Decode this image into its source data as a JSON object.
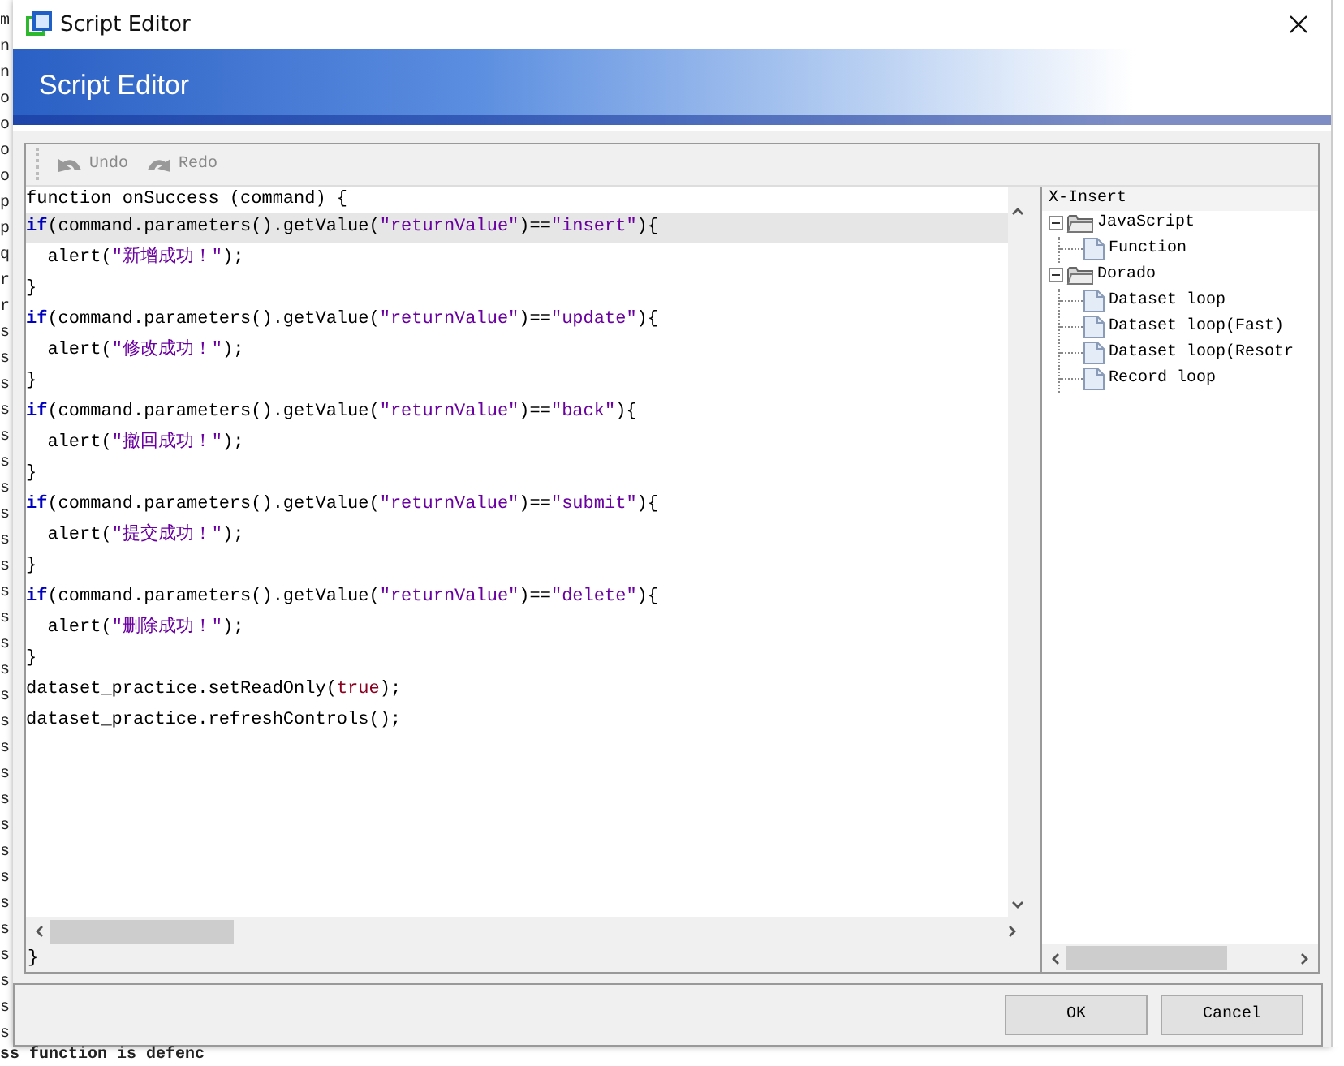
{
  "background": {
    "column_letters": [
      "m",
      "n",
      "n",
      "o",
      "o",
      "o",
      "o",
      "p",
      "p",
      "q",
      "r",
      "r",
      "s",
      "s",
      "s",
      "s",
      "s",
      "s",
      "s",
      "s",
      "s",
      "s",
      "s",
      "s",
      "s",
      "s",
      "s",
      "s",
      "s",
      "s",
      "s",
      "s",
      "s",
      "s",
      "s",
      "s",
      "s",
      "s",
      "s",
      "s"
    ],
    "bottom_text": "ss function is defenc"
  },
  "window": {
    "title": "Script Editor"
  },
  "banner": {
    "title": "Script Editor"
  },
  "toolbar": [
    {
      "kind": "undo",
      "label": "Undo",
      "disabled": true
    },
    {
      "kind": "redo",
      "label": "Redo",
      "disabled": true
    }
  ],
  "code": {
    "lines": [
      {
        "current": false,
        "segments": [
          {
            "kind": "plain",
            "text": "function onSuccess (command) {"
          }
        ]
      },
      {
        "current": true,
        "segments": [
          {
            "kind": "keyword",
            "text": "if"
          },
          {
            "kind": "plain",
            "text": "(command.parameters().getValue("
          },
          {
            "kind": "string",
            "text": "\"returnValue\""
          },
          {
            "kind": "plain",
            "text": ")=="
          },
          {
            "kind": "string",
            "text": "\"insert\""
          },
          {
            "kind": "plain",
            "text": "){"
          }
        ]
      },
      {
        "current": false,
        "segments": [
          {
            "kind": "plain",
            "text": "  alert("
          },
          {
            "kind": "string",
            "text": "\"新增成功！\""
          },
          {
            "kind": "plain",
            "text": ");"
          }
        ]
      },
      {
        "current": false,
        "segments": [
          {
            "kind": "plain",
            "text": "}"
          }
        ]
      },
      {
        "current": false,
        "segments": [
          {
            "kind": "keyword",
            "text": "if"
          },
          {
            "kind": "plain",
            "text": "(command.parameters().getValue("
          },
          {
            "kind": "string",
            "text": "\"returnValue\""
          },
          {
            "kind": "plain",
            "text": ")=="
          },
          {
            "kind": "string",
            "text": "\"update\""
          },
          {
            "kind": "plain",
            "text": "){"
          }
        ]
      },
      {
        "current": false,
        "segments": [
          {
            "kind": "plain",
            "text": "  alert("
          },
          {
            "kind": "string",
            "text": "\"修改成功！\""
          },
          {
            "kind": "plain",
            "text": ");"
          }
        ]
      },
      {
        "current": false,
        "segments": [
          {
            "kind": "plain",
            "text": "}"
          }
        ]
      },
      {
        "current": false,
        "segments": [
          {
            "kind": "keyword",
            "text": "if"
          },
          {
            "kind": "plain",
            "text": "(command.parameters().getValue("
          },
          {
            "kind": "string",
            "text": "\"returnValue\""
          },
          {
            "kind": "plain",
            "text": ")=="
          },
          {
            "kind": "string",
            "text": "\"back\""
          },
          {
            "kind": "plain",
            "text": "){"
          }
        ]
      },
      {
        "current": false,
        "segments": [
          {
            "kind": "plain",
            "text": "  alert("
          },
          {
            "kind": "string",
            "text": "\"撤回成功！\""
          },
          {
            "kind": "plain",
            "text": ");"
          }
        ]
      },
      {
        "current": false,
        "segments": [
          {
            "kind": "plain",
            "text": "}"
          }
        ]
      },
      {
        "current": false,
        "segments": [
          {
            "kind": "keyword",
            "text": "if"
          },
          {
            "kind": "plain",
            "text": "(command.parameters().getValue("
          },
          {
            "kind": "string",
            "text": "\"returnValue\""
          },
          {
            "kind": "plain",
            "text": ")=="
          },
          {
            "kind": "string",
            "text": "\"submit\""
          },
          {
            "kind": "plain",
            "text": "){"
          }
        ]
      },
      {
        "current": false,
        "segments": [
          {
            "kind": "plain",
            "text": "  alert("
          },
          {
            "kind": "string",
            "text": "\"提交成功！\""
          },
          {
            "kind": "plain",
            "text": ");"
          }
        ]
      },
      {
        "current": false,
        "segments": [
          {
            "kind": "plain",
            "text": "}"
          }
        ]
      },
      {
        "current": false,
        "segments": [
          {
            "kind": "keyword",
            "text": "if"
          },
          {
            "kind": "plain",
            "text": "(command.parameters().getValue("
          },
          {
            "kind": "string",
            "text": "\"returnValue\""
          },
          {
            "kind": "plain",
            "text": ")=="
          },
          {
            "kind": "string",
            "text": "\"delete\""
          },
          {
            "kind": "plain",
            "text": "){"
          }
        ]
      },
      {
        "current": false,
        "segments": [
          {
            "kind": "plain",
            "text": "  alert("
          },
          {
            "kind": "string",
            "text": "\"删除成功！\""
          },
          {
            "kind": "plain",
            "text": ");"
          }
        ]
      },
      {
        "current": false,
        "segments": [
          {
            "kind": "plain",
            "text": "}"
          }
        ]
      },
      {
        "current": false,
        "segments": [
          {
            "kind": "plain",
            "text": "dataset_practice.setReadOnly("
          },
          {
            "kind": "literal",
            "text": "true"
          },
          {
            "kind": "plain",
            "text": ");"
          }
        ]
      },
      {
        "current": false,
        "segments": [
          {
            "kind": "plain",
            "text": "dataset_practice.refreshControls();"
          }
        ]
      }
    ],
    "closing_line": "}"
  },
  "tree": {
    "header": "X-Insert",
    "nodes": [
      {
        "kind": "folder",
        "label": "JavaScript",
        "expanded": true,
        "children": [
          {
            "kind": "document",
            "label": "Function"
          }
        ]
      },
      {
        "kind": "folder",
        "label": "Dorado",
        "expanded": true,
        "children": [
          {
            "kind": "document",
            "label": "Dataset loop"
          },
          {
            "kind": "document",
            "label": "Dataset loop(Fast)"
          },
          {
            "kind": "document",
            "label": "Dataset loop(Resotr"
          },
          {
            "kind": "document",
            "label": "Record loop"
          }
        ]
      }
    ]
  },
  "buttons": [
    {
      "label": "OK"
    },
    {
      "label": "Cancel"
    }
  ]
}
